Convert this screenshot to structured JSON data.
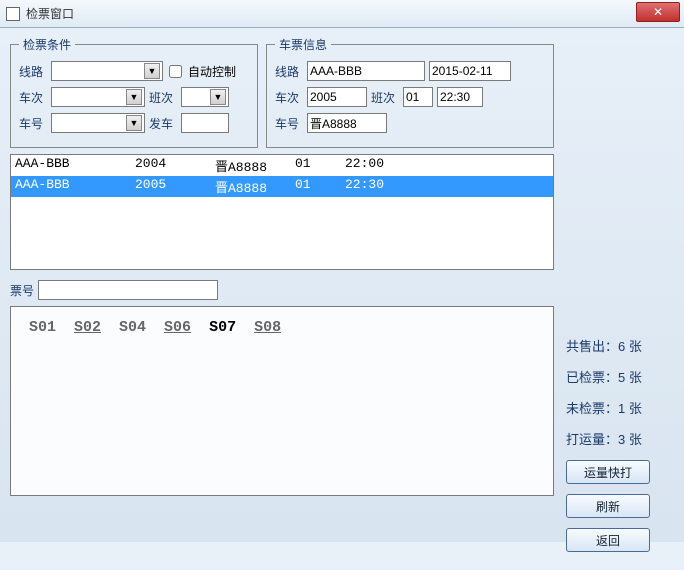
{
  "window": {
    "title": "检票窗口"
  },
  "cond": {
    "legend": "检票条件",
    "route_label": "线路",
    "auto_label": "自动控制",
    "train_label": "车次",
    "shift_label": "班次",
    "car_label": "车号",
    "depart_label": "发车"
  },
  "info": {
    "legend": "车票信息",
    "route_label": "线路",
    "route_value": "AAA-BBB",
    "date_value": "2015-02-11",
    "train_label": "车次",
    "train_value": "2005",
    "shift_label": "班次",
    "shift_value": "01",
    "time_value": "22:30",
    "car_label": "车号",
    "car_value": "晋A8888"
  },
  "list": [
    {
      "route": "AAA-BBB",
      "train": "2004",
      "car": "晋A8888",
      "shift": "01",
      "time": "22:00",
      "selected": false
    },
    {
      "route": "AAA-BBB",
      "train": "2005",
      "car": "晋A8888",
      "shift": "01",
      "time": "22:30",
      "selected": true
    }
  ],
  "ticket": {
    "label": "票号",
    "value": ""
  },
  "seats": [
    "S01",
    "S02",
    "S04",
    "S06",
    "S07",
    "S08"
  ],
  "seats_underlined": [
    "S02",
    "S06",
    "S08"
  ],
  "seats_current": "S07",
  "stats": {
    "sold": "共售出：6 张",
    "checked": "已检票：5 张",
    "unchecked": "未检票：1 张",
    "capacity": "打运量：3 张"
  },
  "buttons": {
    "quickprint": "运量快打",
    "refresh": "刷新",
    "back": "返回"
  }
}
